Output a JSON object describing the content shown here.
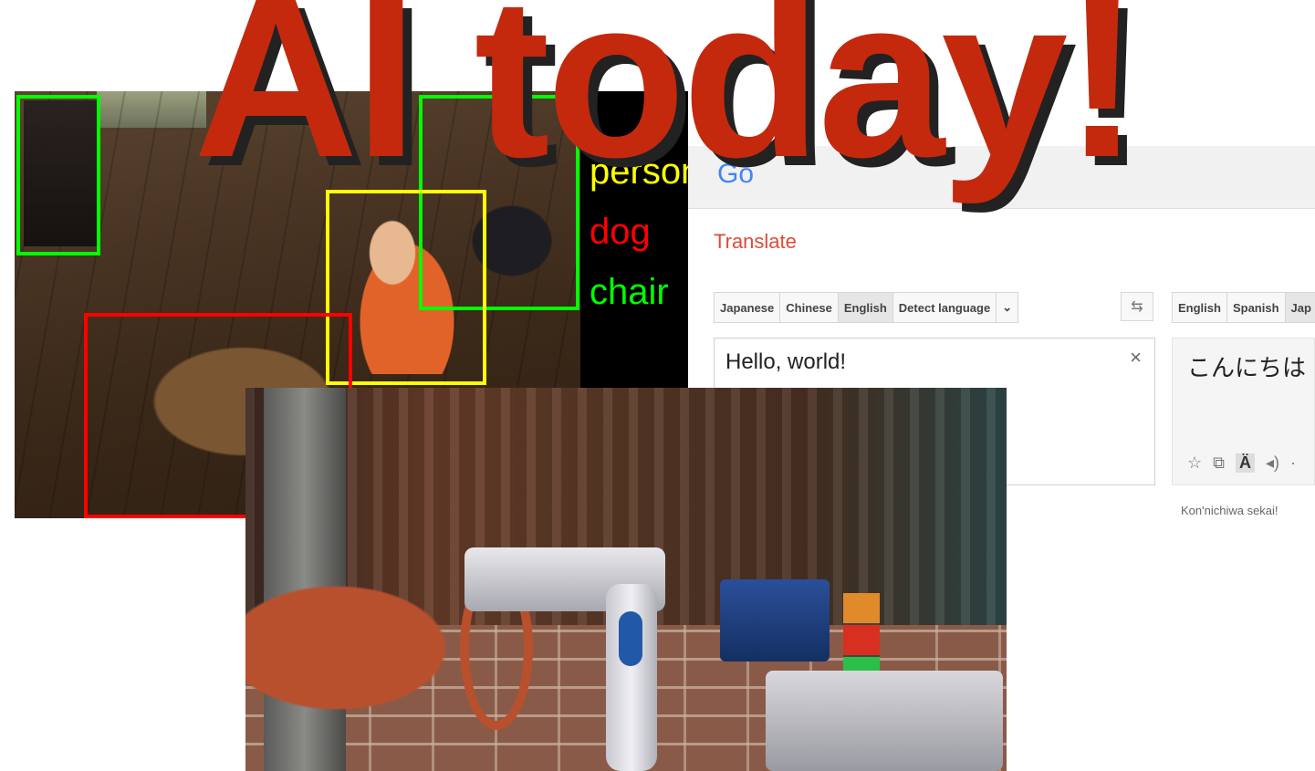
{
  "headline": "AI today!",
  "detection": {
    "labels": [
      {
        "text": "person",
        "color": "#ffff00"
      },
      {
        "text": "dog",
        "color": "#ff0000"
      },
      {
        "text": "chair",
        "color": "#00ff00"
      }
    ],
    "box_colors": {
      "chair": "#00ff00",
      "person": "#ffff00",
      "dog": "#ff0000"
    }
  },
  "translate": {
    "logo_text": "Go",
    "title": "Translate",
    "source_languages": [
      "Japanese",
      "Chinese",
      "English",
      "Detect language",
      "⌄"
    ],
    "source_selected": "English",
    "target_languages": [
      "English",
      "Spanish",
      "Jap"
    ],
    "swap_icon": "⇆",
    "source_text": "Hello, world!",
    "clear_icon": "×",
    "translated_text": "こんにちは",
    "tools": [
      "☆",
      "⧉",
      "Ä",
      "◂)",
      "·"
    ],
    "romanization": "Kon'nichiwa sekai!"
  },
  "colors": {
    "headline": "#c4290d",
    "headline_shadow": "#222222",
    "translate_title": "#dd4b39"
  }
}
